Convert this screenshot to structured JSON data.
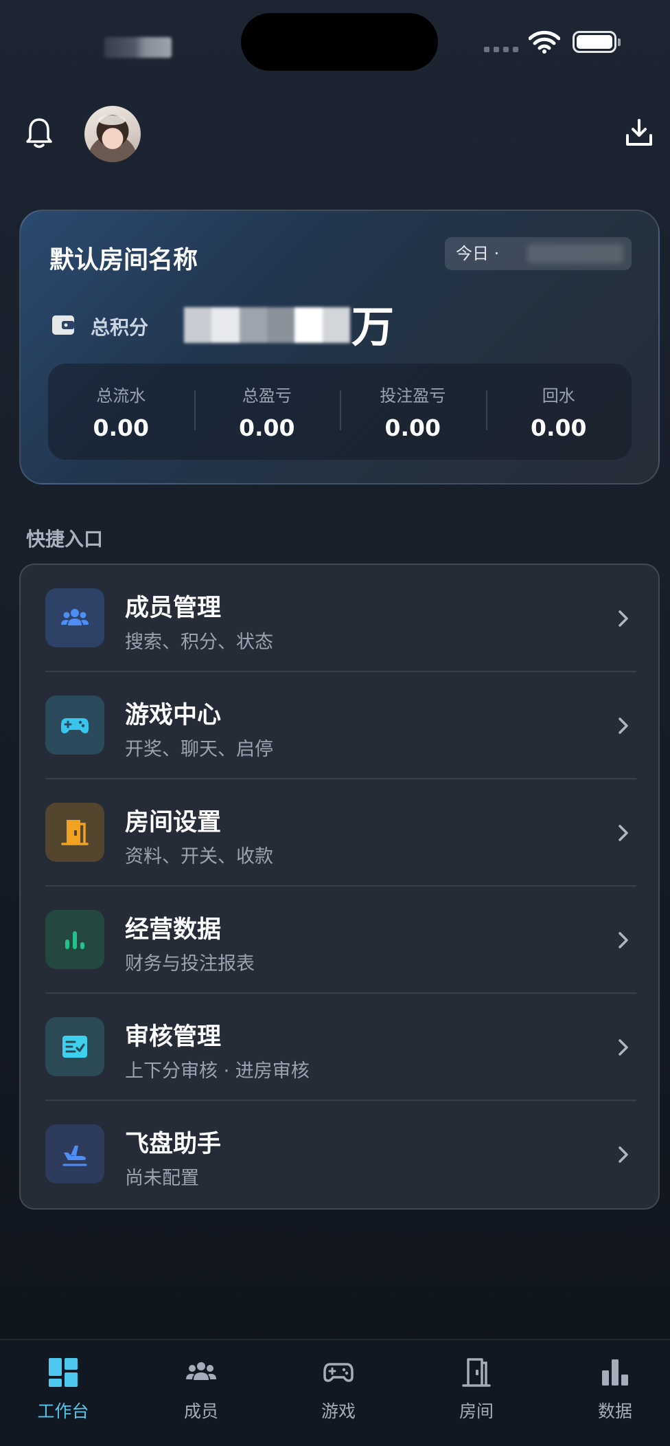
{
  "header": {
    "avatar_alt": "avatar"
  },
  "summary": {
    "room_name": "默认房间名称",
    "date_label": "今日 ·",
    "total_points_label": "总积分",
    "points_unit": "万",
    "stats": [
      {
        "label": "总流水",
        "value": "0.00"
      },
      {
        "label": "总盈亏",
        "value": "0.00"
      },
      {
        "label": "投注盈亏",
        "value": "0.00"
      },
      {
        "label": "回水",
        "value": "0.00"
      }
    ]
  },
  "quick": {
    "section_title": "快捷入口",
    "items": [
      {
        "title": "成员管理",
        "subtitle": "搜索、积分、状态",
        "icon": "members-icon",
        "color": "#4f8ef7",
        "bg": "#2d4266"
      },
      {
        "title": "游戏中心",
        "subtitle": "开奖、聊天、启停",
        "icon": "gamepad-icon",
        "color": "#38c6ee",
        "bg": "#2b4a5c"
      },
      {
        "title": "房间设置",
        "subtitle": "资料、开关、收款",
        "icon": "door-icon",
        "color": "#f0a323",
        "bg": "#54452e"
      },
      {
        "title": "经营数据",
        "subtitle": "财务与投注报表",
        "icon": "bar-chart-icon",
        "color": "#22c38b",
        "bg": "#24473f"
      },
      {
        "title": "审核管理",
        "subtitle": "上下分审核 · 进房审核",
        "icon": "checklist-icon",
        "color": "#3dd0ef",
        "bg": "#2b4a55"
      },
      {
        "title": "飞盘助手",
        "subtitle": "尚未配置",
        "icon": "plane-icon",
        "color": "#4f8ef7",
        "bg": "#2d3c5c"
      }
    ]
  },
  "tabs": [
    {
      "label": "工作台",
      "icon": "dashboard-icon",
      "active": true
    },
    {
      "label": "成员",
      "icon": "members-icon"
    },
    {
      "label": "游戏",
      "icon": "gamepad-icon"
    },
    {
      "label": "房间",
      "icon": "door-icon"
    },
    {
      "label": "数据",
      "icon": "bar-chart-icon"
    }
  ],
  "colors": {
    "accent": "#4fc8f0",
    "background": "#19202c",
    "card": "#262c37"
  }
}
